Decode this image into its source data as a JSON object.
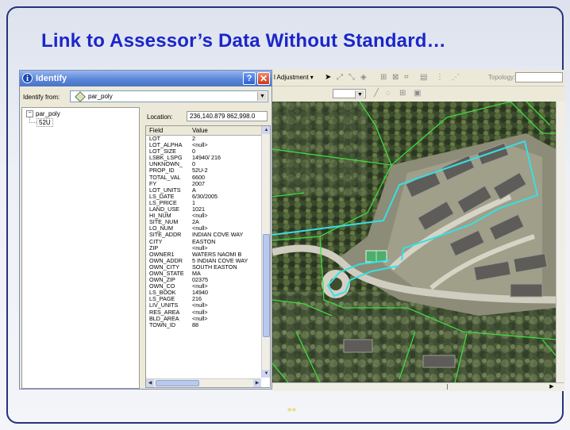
{
  "slide": {
    "title": "Link to Assessor’s Data Without Standard…",
    "footer_mark": "**"
  },
  "identify_window": {
    "title": "Identify",
    "help_label": "?",
    "close_label": "✕",
    "identify_from_label": "Identify from:",
    "identify_from_value": "par_poly",
    "tree": {
      "root": "par_poly",
      "root_toggle": "−",
      "child": "52U"
    },
    "location_label": "Location:",
    "location_value": "236,140.879  862,998.0",
    "columns": [
      "Field",
      "Value"
    ],
    "rows": [
      {
        "field": "LOT",
        "value": "2"
      },
      {
        "field": "LOT_ALPHA",
        "value": "<null>"
      },
      {
        "field": "LOT_SIZE",
        "value": "0"
      },
      {
        "field": "LSBK_LSPG",
        "value": "14940/ 216"
      },
      {
        "field": "UNKNOWN_",
        "value": "0"
      },
      {
        "field": "PROP_ID",
        "value": "52U-2"
      },
      {
        "field": "TOTAL_VAL",
        "value": "6600"
      },
      {
        "field": "FY",
        "value": "2007"
      },
      {
        "field": "LOT_UNITS",
        "value": "A"
      },
      {
        "field": "LS_DATE",
        "value": "6/30/2005"
      },
      {
        "field": "LS_PRICE",
        "value": "1"
      },
      {
        "field": "LAND_USE",
        "value": "1021"
      },
      {
        "field": "HI_NUM",
        "value": "<null>"
      },
      {
        "field": "SITE_NUM",
        "value": "2A"
      },
      {
        "field": "LO_NUM",
        "value": "<null>"
      },
      {
        "field": "SITE_ADDR",
        "value": "INDIAN COVE WAY"
      },
      {
        "field": "CITY",
        "value": "EASTON"
      },
      {
        "field": "ZIP",
        "value": "<null>"
      },
      {
        "field": "OWNER1",
        "value": "WATERS NAOMI B"
      },
      {
        "field": "OWN_ADDR",
        "value": "5 INDIAN COVE WAY"
      },
      {
        "field": "OWN_CITY",
        "value": "SOUTH EASTON"
      },
      {
        "field": "OWN_STATE",
        "value": "MA"
      },
      {
        "field": "OWN_ZIP",
        "value": "02375"
      },
      {
        "field": "OWN_CO",
        "value": "<null>"
      },
      {
        "field": "LS_BOOK",
        "value": "14940"
      },
      {
        "field": "LS_PAGE",
        "value": "216"
      },
      {
        "field": "LIV_UNITS",
        "value": "<null>"
      },
      {
        "field": "RES_AREA",
        "value": "<null>"
      },
      {
        "field": "BLD_AREA",
        "value": "<null>"
      },
      {
        "field": "TOWN_ID",
        "value": "88"
      }
    ]
  },
  "arcmap": {
    "adjustment_label": "l Adjustment ▾",
    "topology_label": "Topology:",
    "toolbar1_icons": [
      "pointer-icon",
      "edit-vertex-icon",
      "reshape-icon",
      "rotate-icon",
      "table-icon",
      "attribute-icon",
      "snap-icon",
      "grid-icon",
      "split-icon",
      "merge-icon"
    ],
    "toolbar2_icons": [
      "sketch-icon",
      "circle-icon",
      "grid-icon",
      "square-icon"
    ]
  },
  "colors": {
    "title": "#1b26c8",
    "parcel_lines": "#3ddc3d",
    "selected_parcel": "#35e0e6",
    "slide_border": "#24347a"
  }
}
